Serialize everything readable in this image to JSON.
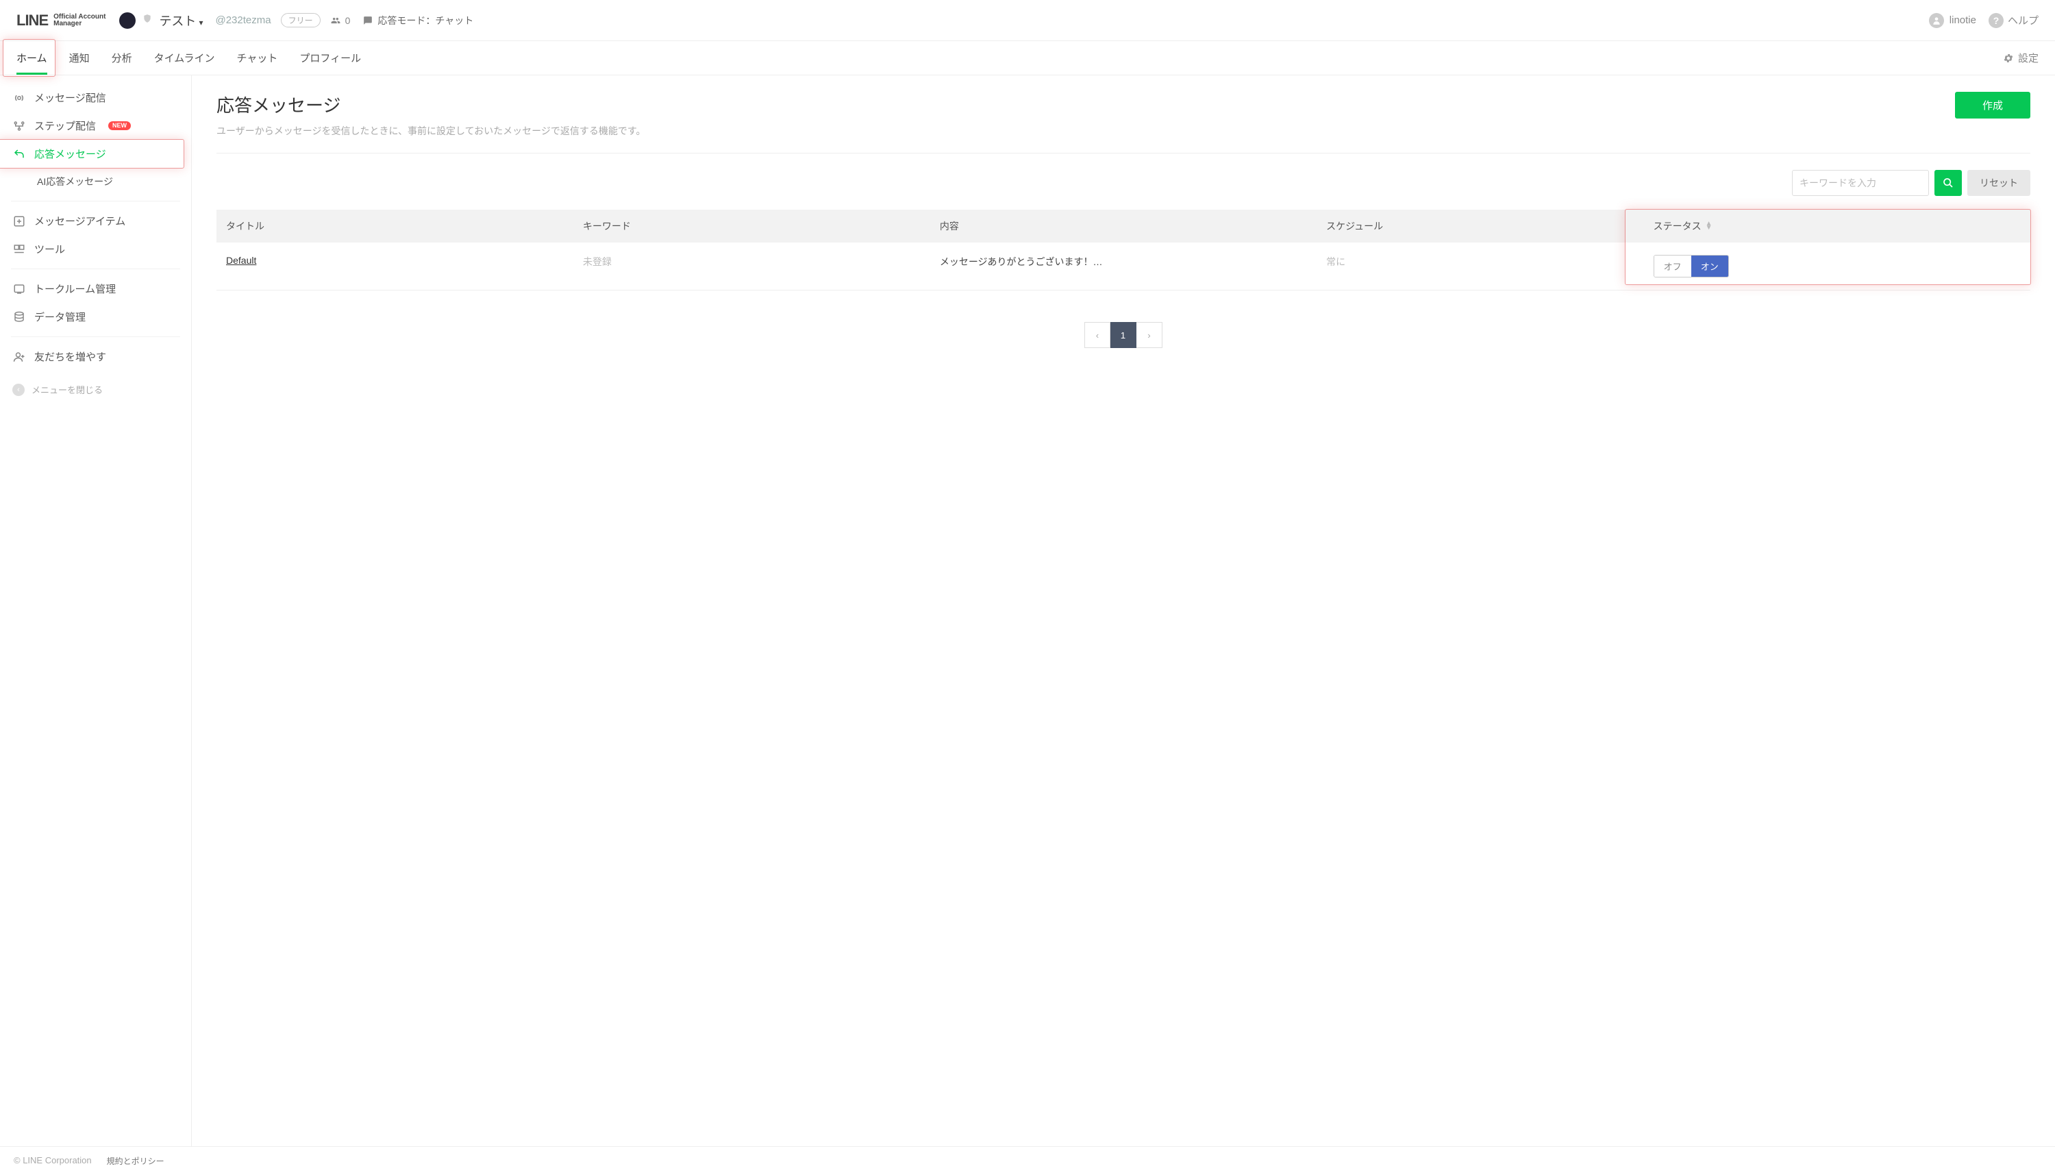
{
  "header": {
    "logo_main": "LINE",
    "logo_sub1": "Official Account",
    "logo_sub2": "Manager",
    "account_name": "テスト",
    "handle": "@232tezma",
    "plan_badge": "フリー",
    "friends_count": "0",
    "response_mode_label": "応答モード：チャット",
    "username": "linotie",
    "help_label": "ヘルプ"
  },
  "tabs": {
    "home": "ホーム",
    "notify": "通知",
    "analysis": "分析",
    "timeline": "タイムライン",
    "chat": "チャット",
    "profile": "プロフィール",
    "settings": "設定"
  },
  "sidebar": {
    "broadcast": "メッセージ配信",
    "step": "ステップ配信",
    "step_badge": "NEW",
    "auto_response": "応答メッセージ",
    "ai_response": "AI応答メッセージ",
    "message_item": "メッセージアイテム",
    "tools": "ツール",
    "talkroom": "トークルーム管理",
    "data": "データ管理",
    "grow_friends": "友だちを増やす",
    "close_menu": "メニューを閉じる"
  },
  "page": {
    "title": "応答メッセージ",
    "subtitle": "ユーザーからメッセージを受信したときに、事前に設定しておいたメッセージで返信する機能です。",
    "create_button": "作成",
    "search_placeholder": "キーワードを入力",
    "reset_button": "リセット"
  },
  "table": {
    "headers": {
      "title": "タイトル",
      "keyword": "キーワード",
      "content": "内容",
      "schedule": "スケジュール",
      "status": "ステータス"
    },
    "rows": [
      {
        "title": "Default",
        "keyword": "未登録",
        "content": "メッセージありがとうございます！…",
        "schedule": "常に",
        "status_off": "オフ",
        "status_on": "オン"
      }
    ]
  },
  "pager": {
    "page": "1"
  },
  "footer": {
    "copyright": "© LINE Corporation",
    "policy": "規約とポリシー"
  }
}
